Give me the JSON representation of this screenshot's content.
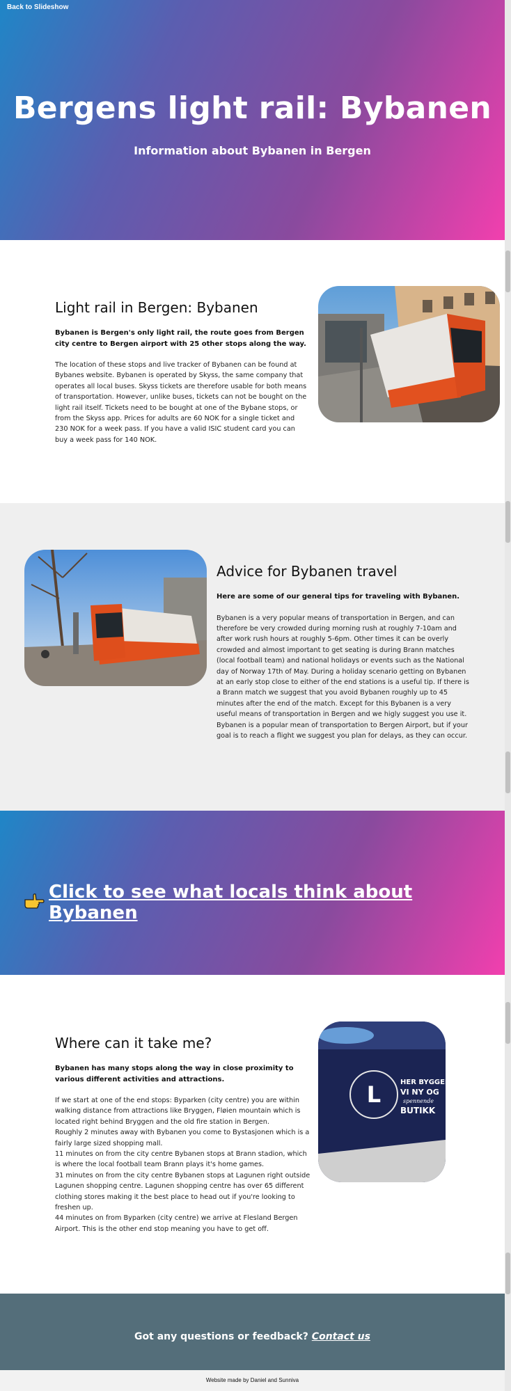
{
  "nav": {
    "back_label": "Back to Slideshow"
  },
  "hero": {
    "title": "Bergens light rail: Bybanen",
    "subtitle": "Information about Bybanen in Bergen"
  },
  "section1": {
    "heading": "Light rail in Bergen: Bybanen",
    "lead": "Bybanen is Bergen's only light rail, the route goes from Bergen city centre to Bergen airport with 25 other stops along the way.",
    "body": "The location of these stops and live tracker of Bybanen can be found at Bybanes website. Bybanen is operated by Skyss, the same company that operates all local buses. Skyss tickets are therefore usable for both means of transportation. However, unlike buses, tickets can not be bought on the light rail itself. Tickets need to be bought at one of the Bybane stops, or from the Skyss app. Prices for adults are 60 NOK for a single ticket and 230 NOK for a week pass. If you have a valid ISIC student card you can buy a week pass for 140 NOK."
  },
  "section2": {
    "heading": "Advice for Bybanen travel",
    "lead": "Here are some of our general tips for traveling with Bybanen.",
    "body": "Bybanen is a very popular means of transportation in Bergen, and can therefore be very crowded during morning rush at roughly 7-10am and after work rush hours at roughly 5-6pm. Other times it can be overly crowded and almost important to get seating is during Brann matches (local football team) and national holidays or events such as the National day of Norway 17th of May. During a holiday scenario getting on Bybanen at an early stop close to either of the end stations is a useful tip. If there is a Brann match we suggest that you avoid Bybanen roughly up to 45 minutes after the end of the match. Except for this Bybanen is a very useful means of transportation in Bergen and we higly suggest you use it. Bybanen is a popular mean of transportation to Bergen Airport, but if your goal is to reach a flight we suggest you plan for delays, as they can occur."
  },
  "cta": {
    "icon": "pointing-hand-icon",
    "label": "Click to see what locals think about Bybanen"
  },
  "section4": {
    "heading": "Where can it take me?",
    "lead": "Bybanen has many stops along the way in close proximity to various different activities and attractions.",
    "body": "If we start at one of the end stops: Byparken (city centre) you are within walking distance from attractions like Bryggen, Fløien mountain which is located right behind Bryggen and the old fire station in Bergen.\nRoughly 2 minutes away with Bybanen you come to Bystasjonen which is a fairly large sized shopping mall.\n11 minutes on from the city centre Bybanen stops at Brann stadion, which is where the local football team Brann plays it's home games.\n31 minutes on from the city centre Bybanen stops at Lagunen right outside Lagunen shopping centre. Lagunen shopping centre has over 65 different clothing stores making it the best place to head out if you're looking to freshen up.\n44 minutes on from Byparken (city centre) we arrive at Flesland Bergen Airport. This is the other end stop meaning you have to get off.",
    "banner_text": [
      "HER BYGGER",
      "VI NY OG",
      "spennende",
      "BUTIKK"
    ]
  },
  "footer": {
    "question": "Got any questions or feedback?",
    "contact_label": "Contact us",
    "credit": "Website made by Daniel and Sunniva"
  },
  "colors": {
    "gradient_start": "#1f86c7",
    "gradient_end": "#f23fae",
    "footer_band": "#546e7a",
    "section_grey": "#efefef"
  }
}
